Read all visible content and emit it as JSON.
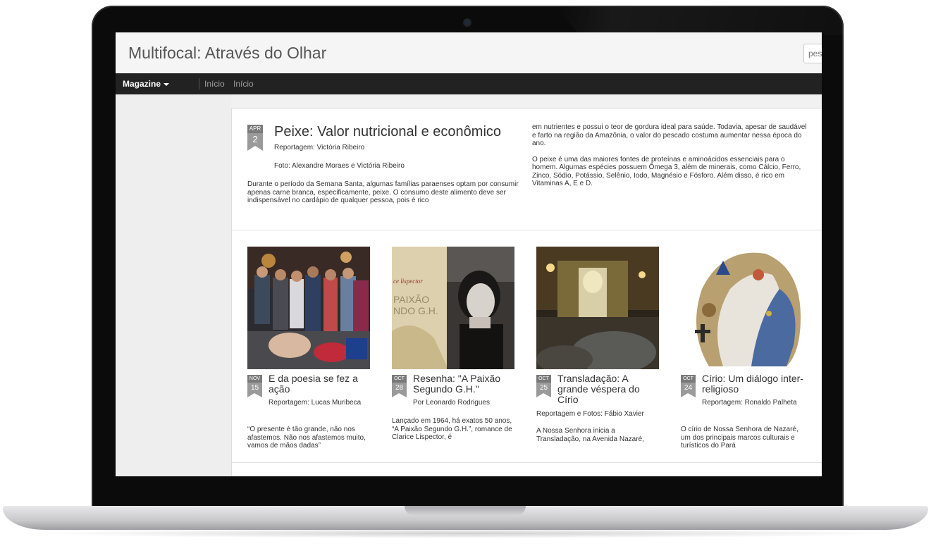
{
  "site": {
    "title": "Multifocal: Através do Olhar",
    "search_placeholder": "pes"
  },
  "nav": {
    "magazine_label": "Magazine",
    "links": [
      "Início",
      "Início"
    ]
  },
  "featured": {
    "month": "APR",
    "day": "2",
    "title": "Peixe: Valor nutricional e econômico",
    "byline": "Reportagem: Victória Ribeiro",
    "photo_credit": "Foto: Alexandre Moraes e Victória Ribeiro",
    "col1": "Durante o período da Semana Santa, algumas famílias paraenses optam por consumir apenas carne branca, especificamente, peixe. O consumo deste alimento deve ser indispensável no cardápio de qualquer pessoa, pois é rico",
    "col2_p1": "em nutrientes e possui o teor de gordura ideal para saúde. Todavia, apesar de saudável e farto na região da Amazônia, o valor do pescado costuma aumentar nessa época do ano.",
    "col2_p2": "O peixe é uma das maiores fontes de proteínas e aminoácidos essenciais para o homem. Algumas espécies possuem Ômega 3, além de minerais, como Cálcio, Ferro, Zinco, Sódio, Potássio, Selênio, Iodo, Magnésio e Fósforo. Além disso, é rico em Vitaminas A, E e D."
  },
  "cards": [
    {
      "month": "NOV",
      "day": "15",
      "title": "E da poesia se fez a ação",
      "byline": "Reportagem: Lucas Muribeca",
      "excerpt": "“O presente é tão grande, não nos afastemos. Não nos afastemos muito, vamos de mãos dadas”"
    },
    {
      "month": "OCT",
      "day": "28",
      "title": "Resenha: \"A Paixão Segundo G.H.\"",
      "byline": "Por Leonardo Rodrigues",
      "excerpt": "Lançado em 1964, há exatos 50 anos, “A Paixão Segundo G.H.”, romance de Clarice Lispector, é"
    },
    {
      "month": "OCT",
      "day": "25",
      "title": "Transladação: A grande véspera do Círio",
      "byline": "Reportagem e Fotos: Fábio Xavier",
      "excerpt": "A Nossa Senhora inicia a Transladação, na Avenida Nazaré,"
    },
    {
      "month": "OCT",
      "day": "24",
      "title": "Círio: Um diálogo inter-religioso",
      "byline": "Reportagem: Ronaldo Palheta",
      "excerpt": "O círio de Nossa Senhora de Nazaré, um dos principais marcos culturais e turísticos do Pará"
    }
  ],
  "book_cover": {
    "line1": "PAIXÃO",
    "line2": "NDO G.H.",
    "script": "ce lispector"
  }
}
